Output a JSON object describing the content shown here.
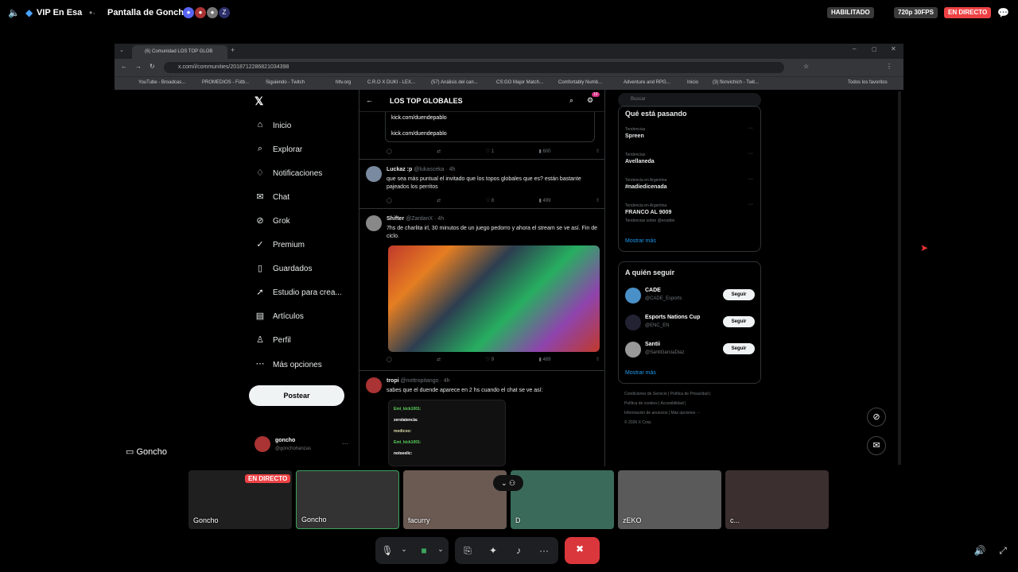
{
  "discord": {
    "channel": "VIP En Esa",
    "stream_title": "Pantalla de Goncho",
    "habilitado": "HABILITADO",
    "quality": "720p 30FPS",
    "live": "EN DIRECTO",
    "streamer_label": "Goncho",
    "participants": [
      {
        "name": "Goncho",
        "live": "EN DIRECTO"
      },
      {
        "name": "Goncho"
      },
      {
        "name": "facurry"
      },
      {
        "name": "D"
      },
      {
        "name": "zEKO"
      },
      {
        "name": "c..."
      }
    ]
  },
  "browser": {
    "tab_title": "(6) Comunidad LOS TOP GLOB",
    "url": "x.com/i/communities/2018712286821034398",
    "bookmarks": [
      "YouTube - Broadcas...",
      "PROMEDIOS - Fútb...",
      "Siguiendo - Twitch",
      "hltv.org",
      "C.R.O X DUKI - LEX...",
      "(57) Análisis del can...",
      "CS:GO Major Match...",
      "Comfortably Numb...",
      "Adventure and RPG...",
      "Inicio",
      "(3) flonvichich - Twit..."
    ],
    "bookmarks_all": "Todos los favoritos"
  },
  "twitter": {
    "nav": [
      "Inicio",
      "Explorar",
      "Notificaciones",
      "Chat",
      "Grok",
      "Premium",
      "Guardados",
      "Estudio para crea...",
      "Artículos",
      "Perfil",
      "Más opciones"
    ],
    "post_button": "Postear",
    "user": {
      "name": "goncho",
      "handle": "@gonchohanzas"
    },
    "community": "LOS TOP GLOBALES",
    "notif_count": "10",
    "top_links": [
      "kick.com/duendepablo",
      "kick.com/duendepablo"
    ],
    "top_stats": {
      "likes": "1",
      "views": "600"
    },
    "tweets": [
      {
        "name": "Luckaz :p",
        "handle": "@lukasceka · 4h",
        "text": "que sea más puntual el invitado que los topos globales que es? están bastante pajeados los perritos",
        "likes": "8",
        "views": "499"
      },
      {
        "name": "Shifter",
        "handle": "@ZardanX · 4h",
        "text": "7hs de charlita irl, 30 minutos de un juego pedorro y ahora el stream se ve así. Fin de ciclo.",
        "likes": "9",
        "views": "489"
      },
      {
        "name": "tropi",
        "handle": "@nottropitango · 4h",
        "text": "sabes que el duende aparece en 2 hs cuando el chat se ve así:"
      }
    ],
    "chat_lines": [
      "Emi_kick1001:",
      "zerolatencia:",
      "medicoo:",
      "Emi_kick1001:",
      "notseelic:"
    ],
    "search_placeholder": "Buscar",
    "trending_title": "Qué está pasando",
    "trends": [
      {
        "ctx": "Tendencias",
        "name": "Spreen"
      },
      {
        "ctx": "Tendencias",
        "name": "Avellaneda"
      },
      {
        "ctx": "Tendencia en Argentina",
        "name": "#nadiedicenada"
      },
      {
        "ctx": "Tendencia en Argentina",
        "name": "FRANCO AL 9009",
        "sub": "Tendencias sobre @eruddio"
      }
    ],
    "show_more": "Mostrar más",
    "who_to_follow": "A quién seguir",
    "follows": [
      {
        "name": "CADE",
        "handle": "@CADE_Esports"
      },
      {
        "name": "Esports Nations Cup",
        "handle": "@ENC_EN"
      },
      {
        "name": "Santii",
        "handle": "@SantiGarciaDiaz"
      }
    ],
    "follow_label": "Seguir",
    "footer": [
      "Condiciones de Servicio  |  Política de Privacidad  |",
      "Política de cookies  |  Accesibilidad  |",
      "Información de anuncios  |  Más opciones ···",
      "© 2026 X Corp."
    ]
  },
  "colors": {
    "live": "#ed4245",
    "accent": "#1d9bf0",
    "end_call": "#da373c"
  }
}
